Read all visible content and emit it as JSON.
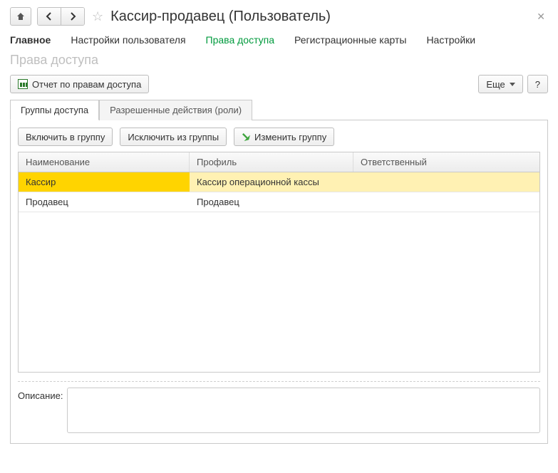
{
  "header": {
    "title": "Кассир-продавец (Пользователь)"
  },
  "menu": {
    "main": "Главное",
    "user_settings": "Настройки пользователя",
    "access_rights": "Права доступа",
    "reg_cards": "Регистрационные карты",
    "settings": "Настройки"
  },
  "subtitle": "Права доступа",
  "toolbar": {
    "report": "Отчет по правам доступа",
    "more": "Еще",
    "help": "?"
  },
  "tabs": {
    "groups": "Группы доступа",
    "roles": "Разрешенные действия (роли)"
  },
  "actions": {
    "include": "Включить в группу",
    "exclude": "Исключить из группы",
    "edit": "Изменить группу"
  },
  "table": {
    "headers": {
      "name": "Наименование",
      "profile": "Профиль",
      "responsible": "Ответственный"
    },
    "rows": [
      {
        "name": "Кассир",
        "profile": "Кассир операционной кассы",
        "responsible": ""
      },
      {
        "name": "Продавец",
        "profile": "Продавец",
        "responsible": ""
      }
    ]
  },
  "description_label": "Описание:"
}
